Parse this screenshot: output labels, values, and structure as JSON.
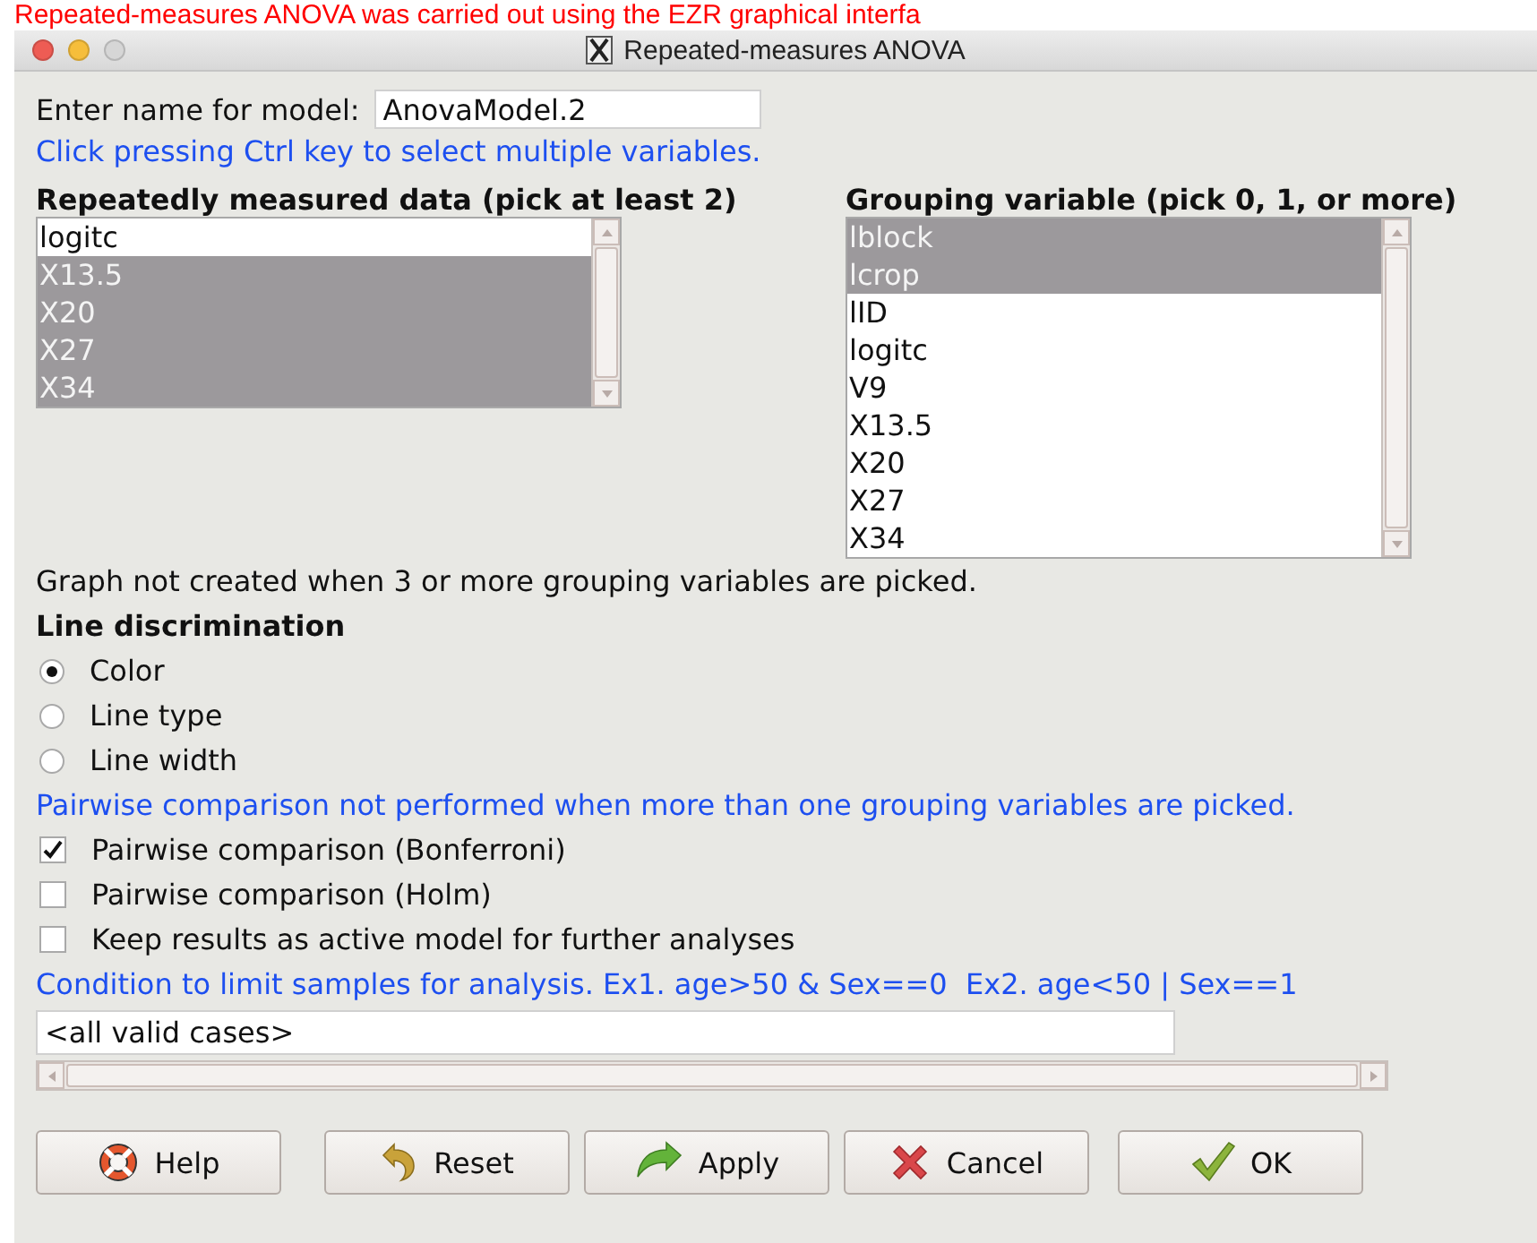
{
  "caption": "Repeated-measures ANOVA was carried out using the EZR graphical interfa",
  "window": {
    "title": "Repeated-measures ANOVA"
  },
  "model_name": {
    "label": "Enter name for model:",
    "value": "AnovaModel.2"
  },
  "hint": "Click pressing Ctrl key to select multiple variables.",
  "repeated_list": {
    "heading": "Repeatedly measured data (pick at least 2)",
    "items": [
      {
        "label": "logitc",
        "selected": false
      },
      {
        "label": "X13.5",
        "selected": true
      },
      {
        "label": "X20",
        "selected": true
      },
      {
        "label": "X27",
        "selected": true
      },
      {
        "label": "X34",
        "selected": true
      }
    ]
  },
  "grouping_list": {
    "heading": "Grouping variable (pick 0, 1, or more)",
    "items": [
      {
        "label": "lblock",
        "selected": true
      },
      {
        "label": "lcrop",
        "selected": true
      },
      {
        "label": "lID",
        "selected": false
      },
      {
        "label": "logitc",
        "selected": false
      },
      {
        "label": "V9",
        "selected": false
      },
      {
        "label": "X13.5",
        "selected": false
      },
      {
        "label": "X20",
        "selected": false
      },
      {
        "label": "X27",
        "selected": false
      },
      {
        "label": "X34",
        "selected": false
      }
    ]
  },
  "graph_note": "Graph not created when 3 or more grouping variables are picked.",
  "line_discrimination": {
    "heading": "Line discrimination",
    "options": [
      {
        "label": "Color",
        "selected": true
      },
      {
        "label": "Line type",
        "selected": false
      },
      {
        "label": "Line width",
        "selected": false
      }
    ]
  },
  "pairwise_note": "Pairwise comparison not performed when more than one grouping variables are picked.",
  "options": [
    {
      "label": "Pairwise comparison (Bonferroni)",
      "checked": true
    },
    {
      "label": "Pairwise comparison (Holm)",
      "checked": false
    },
    {
      "label": "Keep results as active model for further analyses",
      "checked": false
    }
  ],
  "condition": {
    "label": "Condition to limit samples for analysis. Ex1. age>50 & Sex==0  Ex2. age<50 | Sex==1",
    "value": "<all valid cases>"
  },
  "buttons": [
    {
      "label": "Help",
      "kind": "help"
    },
    {
      "label": "Reset",
      "kind": "reset"
    },
    {
      "label": "Apply",
      "kind": "apply"
    },
    {
      "label": "Cancel",
      "kind": "cancel"
    },
    {
      "label": "OK",
      "kind": "ok"
    }
  ]
}
